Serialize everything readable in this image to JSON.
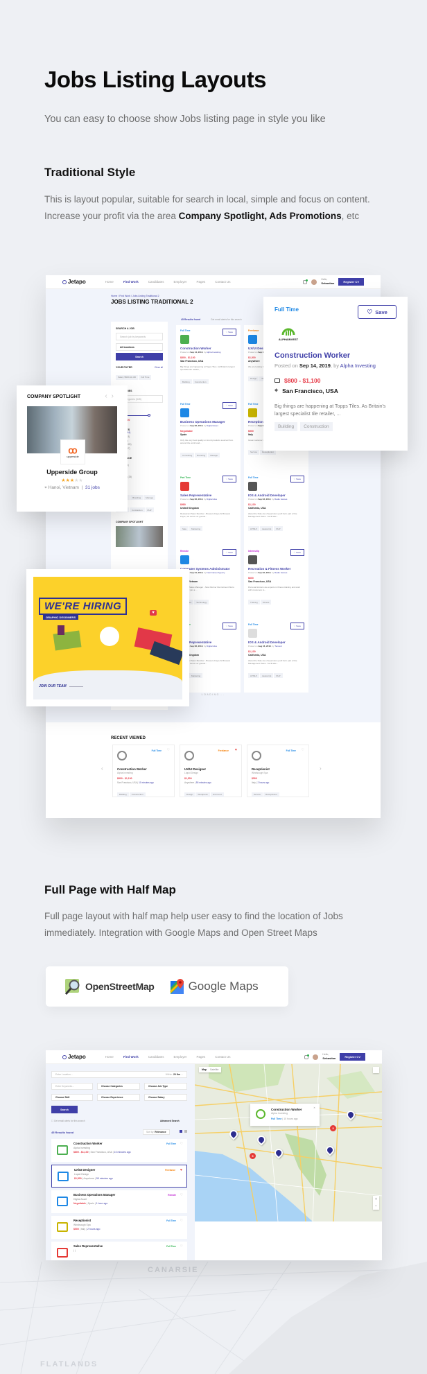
{
  "header": {
    "title": "Jobs Listing Layouts",
    "subtitle": "You can easy to choose show Jobs listing page in style you like"
  },
  "traditional": {
    "title": "Traditional Style",
    "desc_1": "This is layout popular, suitable for search in local, simple and focus on content. Increase your profit via the area ",
    "desc_bold_1": "Company Spotlight, Ads Promotions",
    "desc_2": ", etc",
    "app": {
      "logo": "Jetapo",
      "nav": [
        "Home",
        "Find Work",
        "Candidates",
        "Employer",
        "Pages",
        "Contact Us"
      ],
      "active_nav": "Find Work",
      "hello": "Hello,",
      "user": "Sebastian",
      "register_btn": "Register CV",
      "breadcrumb": "Home / Find Work / Jobs Listing Traditional 2",
      "page_title": "JOBS LISTING TRADITIONAL 2",
      "results": "45 Results found",
      "email_alert": "Get email alerts for this search",
      "sidebar": {
        "search_label": "SEARCH A JOB",
        "search_placeholder": "Search job by keywords",
        "location": "All locations",
        "search_btn": "Search",
        "filter_label": "YOUR FILTER",
        "clear_all": "Clear all",
        "filters": [
          "Salary $500-$1,400",
          "Full Time"
        ],
        "categories_label": "CATEGORIES",
        "categories_value": "All Categories (345)",
        "salary_label": "SALARY",
        "salary_range": "$500 - $1,400",
        "job_types_label": "JOB TYPES",
        "job_types": [
          "Full Time (144)",
          "Part Time (53)",
          "Remote (63)",
          "Freelance (126)",
          "Internship (57)"
        ],
        "experience_label": "EXPERIENCE",
        "experience": [
          "1 years (34)",
          "2 years (105)",
          "3 years (53)",
          "5 years (14)",
          "No required (25)"
        ],
        "skills_label": "SKILLS",
        "skills": [
          "Consulting",
          "Branding",
          "Manage",
          "Marketing",
          "Contraction",
          "PHP"
        ],
        "spotlight_label": "COMPANY SPOTLIGHT"
      },
      "jobs": [
        {
          "type": "Full Time",
          "type_color": "#1e88e5",
          "title": "Construction Worker",
          "date": "Sep 14, 2019",
          "company": "Alpha Investing",
          "salary": "$800 - $1,100",
          "location": "San Francisco, USA",
          "desc": "Big things are happening at Topps Tiles. As Britain's largest specialist tile retailer, ...",
          "tags": [
            "Building",
            "Construction"
          ],
          "logo_color": "#4caf50"
        },
        {
          "type": "Freelance",
          "type_color": "#f57c00",
          "title": "UX/UI Designer",
          "date": "Sep 14, 2019",
          "company": "Liquid Design",
          "salary": "$1,500",
          "location": "Anywhere",
          "desc": "We are looking for a creative designer to manage ...",
          "tags": [
            "Design",
            "Wordpress"
          ],
          "logo_color": "#1e88e5"
        },
        {
          "type": "Full Time",
          "type_color": "#1e88e5",
          "title": "Business Operations Manager",
          "date": "Sep 06, 2019",
          "company": "Digital Asset",
          "salary": "Negotiable",
          "location": "Spain",
          "desc": "Only the very best quality on trend products sourced from around the world and...",
          "tags": [
            "Consulting",
            "Branding",
            "Manage"
          ],
          "logo_color": "#1e88e5"
        },
        {
          "type": "Full Time",
          "type_color": "#1e88e5",
          "title": "Receptionist",
          "date": "Sep 05, 2019",
          "company": "Windsough Spa",
          "salary": "$500",
          "location": "Italy",
          "desc": "Great customer service. That's Topps Tiles...",
          "tags": [
            "Service",
            "Receptionist"
          ],
          "logo_color": "#c8b400"
        },
        {
          "type": "Part Time",
          "type_color": "#2bb24c",
          "title": "Sales Representative",
          "date": "Sep 06, 2019",
          "company": "Digital Hive",
          "salary": "$980",
          "location": "United Kingdom",
          "desc": "Restaurant Team Member - Brewers Fayre At Brewers Fayre, we serve our guests...",
          "tags": [
            "Sale",
            "Marketing"
          ],
          "logo_color": "#e53935"
        },
        {
          "type": "Full Time",
          "type_color": "#1e88e5",
          "title": "IOS & Android Developer",
          "date": "Sep 03, 2019",
          "company": "Radio Games",
          "salary": "$1,100",
          "location": "California, USA",
          "desc": "About the Role As a Supervisor you'll form part of the Management Team. You'll take...",
          "tags": [
            "HTML5",
            "Javascript",
            "PHP"
          ],
          "logo_color": "#555"
        },
        {
          "type": "Remote",
          "type_color": "#c026d3",
          "title": "Computer Systems Administrator",
          "date": "Sep 01, 2019",
          "company": "Fast Career Agency",
          "salary": "$680",
          "location": "Hanoi, Vietnam",
          "desc": "Assistant Sales Manager - New Partner Recruitment We're Advanced join a ...",
          "tags": [
            "Securities",
            "Technology"
          ],
          "logo_color": "#1e88e5"
        },
        {
          "type": "Internship",
          "type_color": "#c026d3",
          "title": "Recreation & Fitness Worker",
          "date": "Sep 02, 2019",
          "company": "Radio Games",
          "salary": "$600",
          "location": "San Francisco, USA",
          "desc": "Personal trainers are experts in fitness training and work with customers to...",
          "tags": [
            "Training",
            "Fitness"
          ],
          "logo_color": "#555"
        },
        {
          "type": "Part Time",
          "type_color": "#2bb24c",
          "title": "Sales Representative",
          "date": "Sep 06, 2019",
          "company": "Digital Hive",
          "salary": "$980",
          "location": "United Kingdom",
          "desc": "Restaurant Team Member - Brewers Fayre At Brewers Fayre, we serve our guests...",
          "tags": [
            "Sale",
            "Marketing"
          ],
          "logo_color": "#e53935"
        },
        {
          "type": "Full Time",
          "type_color": "#1e88e5",
          "title": "IOS & Android Developer",
          "date": "Aug 16, 2019",
          "company": "Tencent",
          "salary": "$1,100",
          "location": "California, USA",
          "desc": "About the Role As a Supervisor you'll form part of the Management Team. You'll take...",
          "tags": [
            "HTML5",
            "Javascript",
            "PHP"
          ],
          "logo_color": "#ddd"
        }
      ],
      "loading": "LOADING...",
      "recent_title": "RECENT VIEWED",
      "recent": [
        {
          "type": "Full Time",
          "type_color": "#1e88e5",
          "title": "Construction Worker",
          "company": "Alpha Investing",
          "salary": "$800 - $1,100",
          "location": "San Francisco, USA",
          "time": "10 minutes ago",
          "tags": [
            "Building",
            "Construction"
          ],
          "fav": false
        },
        {
          "type": "Freelance",
          "type_color": "#f57c00",
          "title": "UX/UI Designer",
          "company": "Liquid Design",
          "salary": "$1,500",
          "location": "Anywhere",
          "time": "55 minutes ago",
          "tags": [
            "Design",
            "Wordpress",
            "Front end"
          ],
          "fav": true
        },
        {
          "type": "Full Time",
          "type_color": "#1e88e5",
          "title": "Receptionist",
          "company": "Windsough Spa",
          "salary": "$500",
          "location": "Italy",
          "time": "2 hours ago",
          "tags": [
            "Service",
            "Receptionist"
          ],
          "fav": false
        }
      ]
    },
    "popup_job": {
      "type": "Full Time",
      "save": "Save",
      "logo_text": "ALPHAINVEST",
      "title": "Construction Worker",
      "posted_on": "Posted on ",
      "date": "Sep 14, 2019",
      "by": ", by ",
      "company": "Alpha Investing",
      "salary": "$800 - $1,100",
      "location": "San Francisco, USA",
      "desc": "Big things are happening at Topps Tiles. As Britain's largest specialist tile retailer, ...",
      "tags": [
        "Building",
        "Construction"
      ]
    },
    "spotlight": {
      "label": "COMPANY SPOTLIGHT",
      "company": "Upperside Group",
      "logo_text": "upperside",
      "rating": 3,
      "rating_max": 5,
      "location": "Hanoi, Vietnam",
      "jobs": "31 jobs"
    },
    "ad": {
      "headline": "WE'RE HIRING",
      "sub": "GRAPHIC DESIGNERS",
      "cta": "JOIN OUR TEAM"
    }
  },
  "halfmap": {
    "title": "Full Page with Half Map",
    "desc": "Full page layout with half map help user easy to find the location of Jobs immediately. Integration with Google Maps and Open Street Maps",
    "providers": [
      "OpenStreetMap",
      "Google Maps"
    ],
    "app": {
      "location_placeholder": "Enter Location...",
      "within_label": "Within:",
      "within_value": "20 Km",
      "keywords_placeholder": "Enter Keywords...",
      "categories": "Choose Categories",
      "job_type": "Choose Job Type",
      "skill": "Choose Skill",
      "experience": "Choose Experience",
      "salary": "Choose Salary",
      "search_btn": "Search",
      "email_alert": "Get email alerts for this search",
      "advanced": "Advanced Search",
      "results": "45 Results found",
      "sort_label": "Sort by:",
      "sort_value": "Relevance",
      "map_tabs": [
        "Map",
        "Satellite"
      ],
      "map_popup": {
        "title": "Construction Worker",
        "company": "Alpha Investing",
        "type": "Full Time",
        "time": "10 hours ago"
      },
      "clusters": [
        "5",
        "3"
      ],
      "rows": [
        {
          "title": "Construction Worker",
          "company": "Alpha Investing",
          "salary": "$800 - $1,100",
          "location": "San Francisco, USA",
          "time": "10 minutes ago",
          "type": "Full Time",
          "type_color": "#1e88e5",
          "fav": false,
          "logo_color": "#4caf50"
        },
        {
          "title": "UX/UI Designer",
          "company": "Liquid Design",
          "salary": "$1,500",
          "location": "Anywhere",
          "time": "55 minutes ago",
          "type": "Freelance",
          "type_color": "#f57c00",
          "fav": true,
          "logo_color": "#1e88e5"
        },
        {
          "title": "Business Operations Manager",
          "company": "Digital Asset",
          "salary": "Negotiable",
          "location": "Spain",
          "time": "1 hour ago",
          "type": "Remote",
          "type_color": "#c026d3",
          "fav": false,
          "logo_color": "#1e88e5"
        },
        {
          "title": "Receptionist",
          "company": "Windsough Spa",
          "salary": "$500",
          "location": "Italy",
          "time": "2 hours ago",
          "type": "Full Time",
          "type_color": "#1e88e5",
          "fav": false,
          "logo_color": "#c8b400"
        },
        {
          "title": "Sales Representative",
          "company": "",
          "salary": "",
          "location": "",
          "time": "",
          "type": "Full Time",
          "type_color": "#2bb24c",
          "fav": false,
          "logo_color": "#e53935"
        }
      ]
    }
  },
  "watermarks": [
    "CANARSIE",
    "FLATLANDS"
  ]
}
